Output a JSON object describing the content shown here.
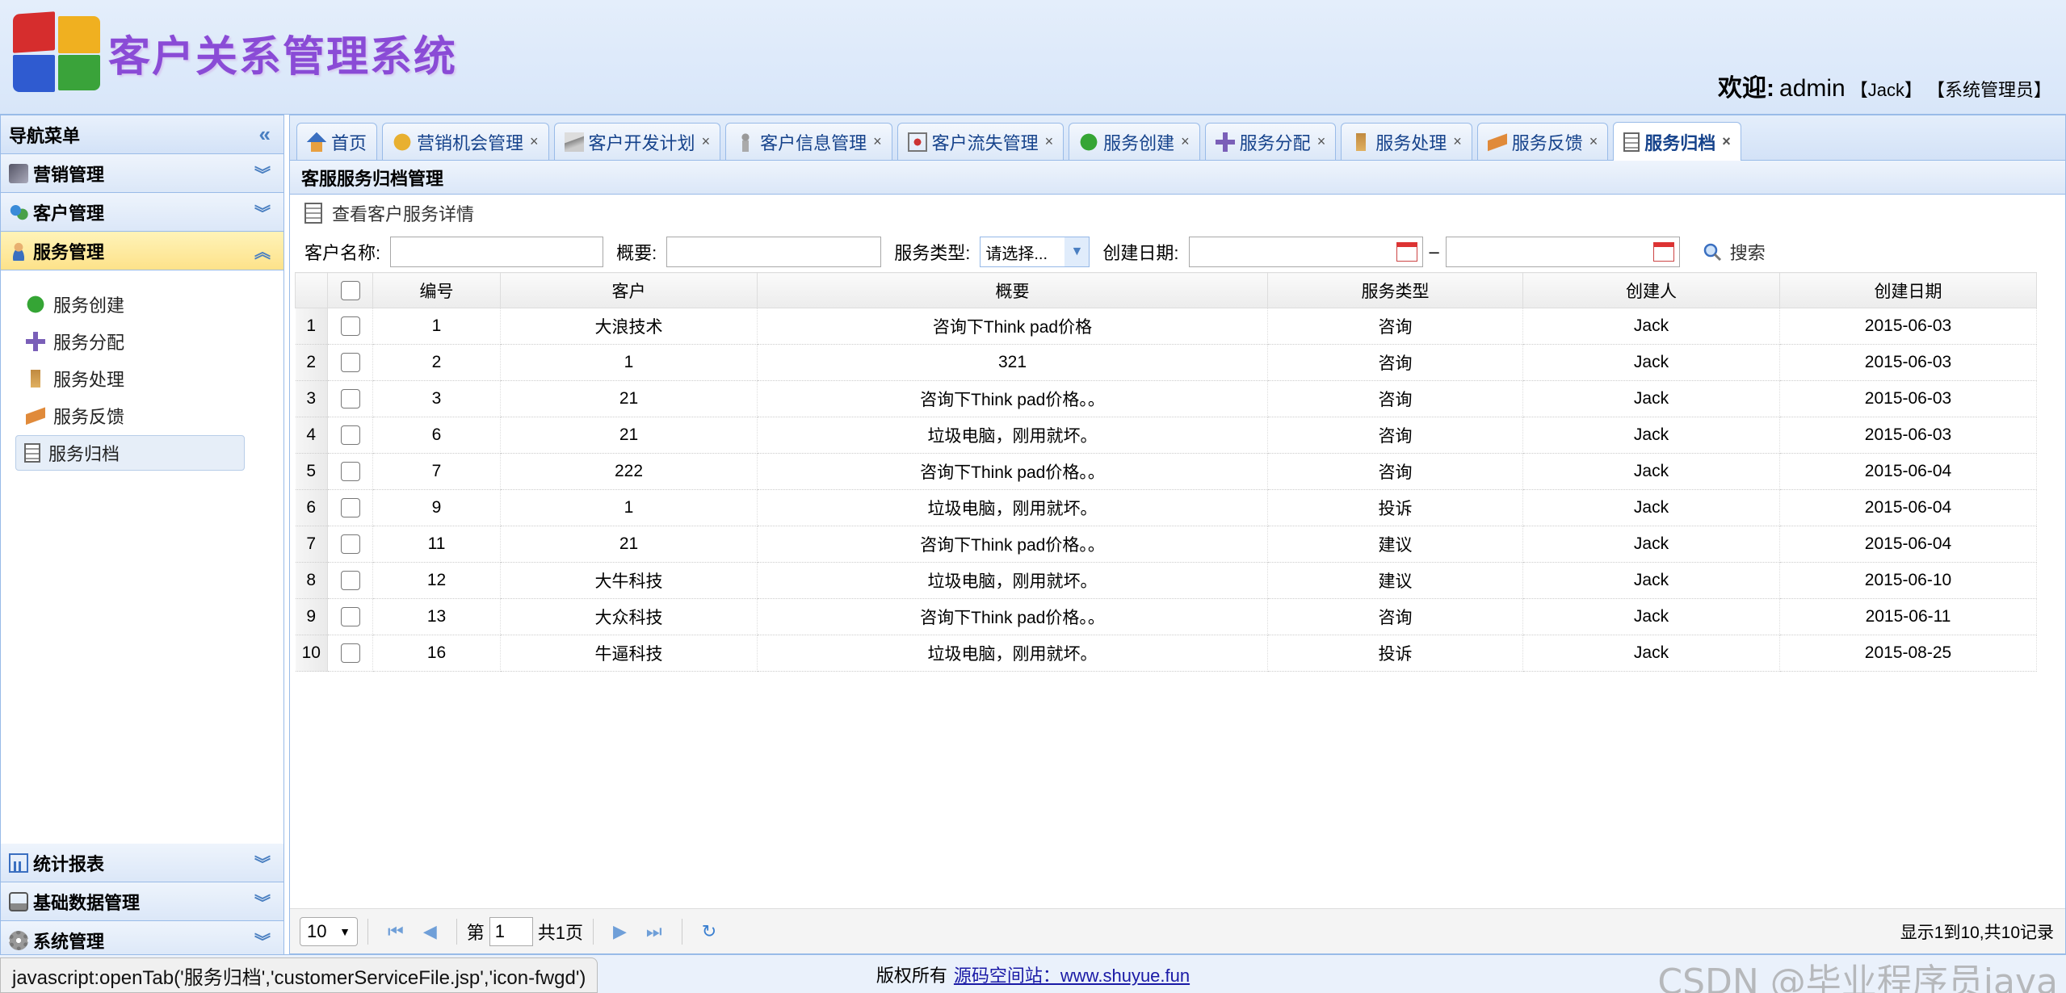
{
  "header": {
    "title": "客户关系管理系统",
    "welcome_label": "欢迎:",
    "username": "admin",
    "display_name": "【Jack】",
    "role": "【系统管理员】"
  },
  "sidebar": {
    "title": "导航菜单",
    "groups": [
      {
        "label": "营销管理"
      },
      {
        "label": "客户管理"
      },
      {
        "label": "服务管理"
      },
      {
        "label": "统计报表"
      },
      {
        "label": "基础数据管理"
      },
      {
        "label": "系统管理"
      }
    ],
    "service_items": [
      {
        "label": "服务创建"
      },
      {
        "label": "服务分配"
      },
      {
        "label": "服务处理"
      },
      {
        "label": "服务反馈"
      },
      {
        "label": "服务归档"
      }
    ]
  },
  "tabs": [
    {
      "label": "首页"
    },
    {
      "label": "营销机会管理"
    },
    {
      "label": "客户开发计划"
    },
    {
      "label": "客户信息管理"
    },
    {
      "label": "客户流失管理"
    },
    {
      "label": "服务创建"
    },
    {
      "label": "服务分配"
    },
    {
      "label": "服务处理"
    },
    {
      "label": "服务反馈"
    },
    {
      "label": "服务归档"
    }
  ],
  "tab_close_glyph": "×",
  "panel": {
    "title": "客服服务归档管理",
    "toolbar_view": "查看客户服务详情",
    "search": {
      "customer_label": "客户名称:",
      "summary_label": "概要:",
      "type_label": "服务类型:",
      "type_value": "请选择...",
      "date_label": "创建日期:",
      "date_sep": "–",
      "search_label": "搜索"
    }
  },
  "table": {
    "columns": [
      "编号",
      "客户",
      "概要",
      "服务类型",
      "创建人",
      "创建日期"
    ],
    "rows": [
      {
        "n": "1",
        "id": "1",
        "customer": "大浪技术",
        "summary": "咨询下Think pad价格",
        "type": "咨询",
        "creator": "Jack",
        "date": "2015-06-03"
      },
      {
        "n": "2",
        "id": "2",
        "customer": "1",
        "summary": "321",
        "type": "咨询",
        "creator": "Jack",
        "date": "2015-06-03"
      },
      {
        "n": "3",
        "id": "3",
        "customer": "21",
        "summary": "咨询下Think pad价格。。",
        "type": "咨询",
        "creator": "Jack",
        "date": "2015-06-03"
      },
      {
        "n": "4",
        "id": "6",
        "customer": "21",
        "summary": "垃圾电脑，刚用就坏。",
        "type": "咨询",
        "creator": "Jack",
        "date": "2015-06-03"
      },
      {
        "n": "5",
        "id": "7",
        "customer": "222",
        "summary": "咨询下Think pad价格。。",
        "type": "咨询",
        "creator": "Jack",
        "date": "2015-06-04"
      },
      {
        "n": "6",
        "id": "9",
        "customer": "1",
        "summary": "垃圾电脑，刚用就坏。",
        "type": "投诉",
        "creator": "Jack",
        "date": "2015-06-04"
      },
      {
        "n": "7",
        "id": "11",
        "customer": "21",
        "summary": "咨询下Think pad价格。。",
        "type": "建议",
        "creator": "Jack",
        "date": "2015-06-04"
      },
      {
        "n": "8",
        "id": "12",
        "customer": "大牛科技",
        "summary": "垃圾电脑，刚用就坏。",
        "type": "建议",
        "creator": "Jack",
        "date": "2015-06-10"
      },
      {
        "n": "9",
        "id": "13",
        "customer": "大众科技",
        "summary": "咨询下Think pad价格。。",
        "type": "咨询",
        "creator": "Jack",
        "date": "2015-06-11"
      },
      {
        "n": "10",
        "id": "16",
        "customer": "牛逼科技",
        "summary": "垃圾电脑，刚用就坏。",
        "type": "投诉",
        "creator": "Jack",
        "date": "2015-08-25"
      }
    ]
  },
  "pager": {
    "page_size": "10",
    "page_prefix": "第",
    "page_value": "1",
    "page_total": "共1页",
    "info": "显示1到10,共10记录"
  },
  "footer": {
    "copyright": "版权所有",
    "link_text": "源码空间站：www.shuyue.fun"
  },
  "statusbar": {
    "text": "javascript:openTab('服务归档','customerServiceFile.jsp','icon-fwgd')"
  },
  "watermark": "CSDN @毕业程序员java",
  "colors": {
    "accent": "#99bbe8",
    "title": "#8a4bd6",
    "active_group": "#fde28a"
  }
}
